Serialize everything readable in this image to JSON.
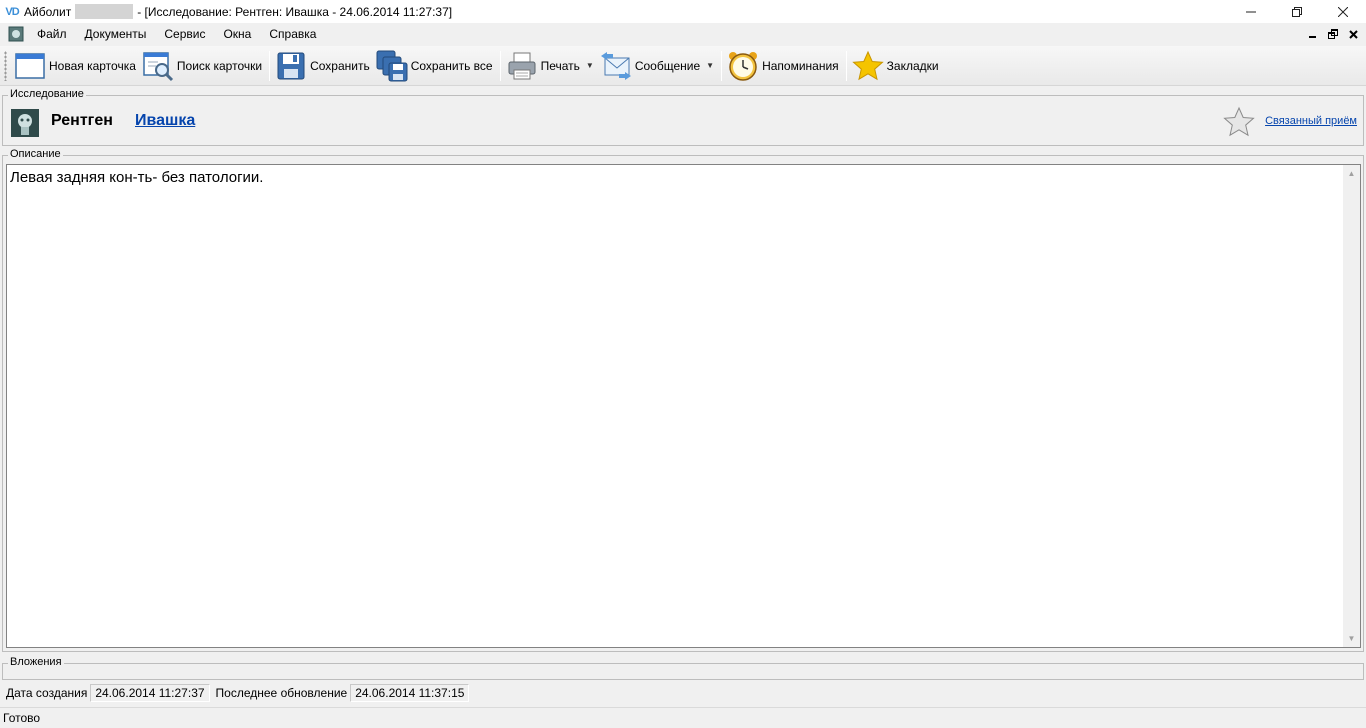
{
  "titlebar": {
    "logo": "VD",
    "app_name": "Айболит",
    "document_title": "- [Исследование: Рентген: Ивашка - 24.06.2014 11:27:37]",
    "minimize": "minimize-icon",
    "restore": "restore-icon",
    "close": "close-icon"
  },
  "menu": {
    "items": [
      "Файл",
      "Документы",
      "Сервис",
      "Окна",
      "Справка"
    ]
  },
  "toolbar": {
    "new_card": "Новая карточка",
    "search_card": "Поиск карточки",
    "save": "Сохранить",
    "save_all": "Сохранить все",
    "print": "Печать",
    "message": "Сообщение",
    "reminders": "Напоминания",
    "bookmarks": "Закладки"
  },
  "research": {
    "group_label": "Исследование",
    "type": "Рентген",
    "patient": "Ивашка",
    "related_link": "Связанный приём"
  },
  "description": {
    "group_label": "Описание",
    "text": "Левая задняя кон-ть- без патологии."
  },
  "attachments": {
    "group_label": "Вложения"
  },
  "dates": {
    "created_label": "Дата создания",
    "created_value": "24.06.2014 11:27:37",
    "updated_label": "Последнее обновление",
    "updated_value": "24.06.2014 11:37:15"
  },
  "status": {
    "text": "Готово"
  },
  "colors": {
    "link": "#0645ad",
    "logo": "#3b8fd8",
    "star": "#f5c400"
  }
}
